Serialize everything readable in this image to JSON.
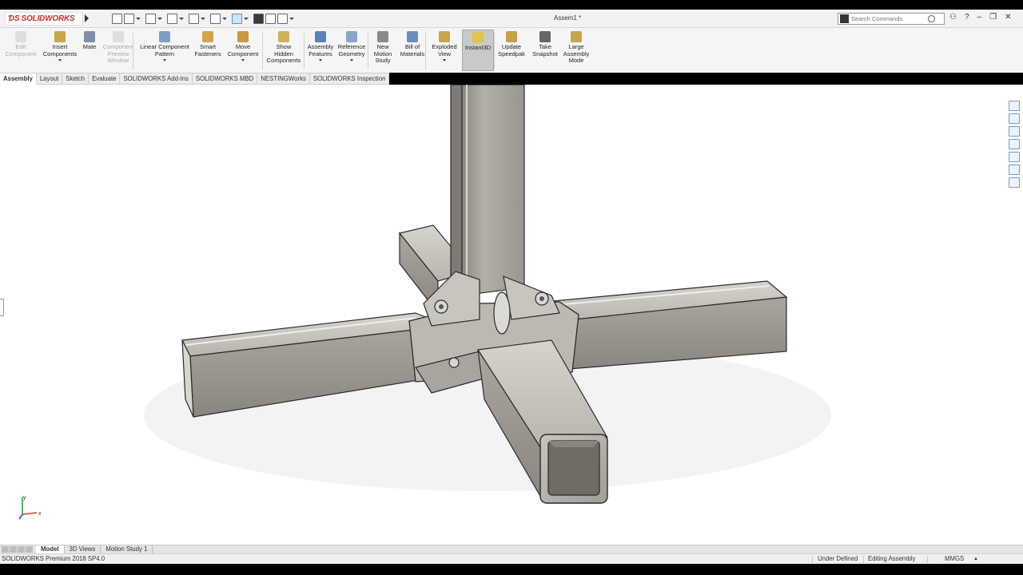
{
  "app": {
    "brand": "SOLIDWORKS",
    "document_title": "Assem1 *"
  },
  "search": {
    "placeholder": "Search Commands"
  },
  "ribbon": {
    "items": [
      {
        "label": "Edit Component",
        "lines": [
          "Edit",
          "Component"
        ],
        "state": "disabled"
      },
      {
        "label": "Insert Components",
        "lines": [
          "Insert",
          "Components"
        ],
        "state": "normal"
      },
      {
        "label": "Mate",
        "lines": [
          "Mate"
        ],
        "state": "normal"
      },
      {
        "label": "Component Preview Window",
        "lines": [
          "Component",
          "Preview",
          "Window"
        ],
        "state": "disabled"
      },
      {
        "label": "Linear Component Pattern",
        "lines": [
          "Linear Component",
          "Pattern"
        ],
        "state": "normal"
      },
      {
        "label": "Smart Fasteners",
        "lines": [
          "Smart",
          "Fasteners"
        ],
        "state": "normal"
      },
      {
        "label": "Move Component",
        "lines": [
          "Move",
          "Component"
        ],
        "state": "normal"
      },
      {
        "label": "Show Hidden Components",
        "lines": [
          "Show",
          "Hidden",
          "Components"
        ],
        "state": "normal"
      },
      {
        "label": "Assembly Features",
        "lines": [
          "Assembly",
          "Features"
        ],
        "state": "normal"
      },
      {
        "label": "Reference Geometry",
        "lines": [
          "Reference",
          "Geometry"
        ],
        "state": "normal"
      },
      {
        "label": "New Motion Study",
        "lines": [
          "New",
          "Motion",
          "Study"
        ],
        "state": "normal"
      },
      {
        "label": "Bill of Materials",
        "lines": [
          "Bill of",
          "Materials"
        ],
        "state": "normal"
      },
      {
        "label": "Exploded View",
        "lines": [
          "Exploded",
          "View"
        ],
        "state": "normal"
      },
      {
        "label": "Instant3D",
        "lines": [
          "Instant3D"
        ],
        "state": "active"
      },
      {
        "label": "Update Speedpak",
        "lines": [
          "Update",
          "Speedpak"
        ],
        "state": "normal"
      },
      {
        "label": "Take Snapshot",
        "lines": [
          "Take",
          "Snapshot"
        ],
        "state": "normal"
      },
      {
        "label": "Large Assembly Mode",
        "lines": [
          "Large",
          "Assembly",
          "Mode"
        ],
        "state": "normal"
      }
    ]
  },
  "tabs": [
    {
      "label": "Assembly",
      "active": true
    },
    {
      "label": "Layout",
      "active": false
    },
    {
      "label": "Sketch",
      "active": false
    },
    {
      "label": "Evaluate",
      "active": false
    },
    {
      "label": "SOLIDWORKS Add-Ins",
      "active": false
    },
    {
      "label": "SOLIDWORKS MBD",
      "active": false
    },
    {
      "label": "NESTINGWorks",
      "active": false
    },
    {
      "label": "SOLIDWORKS Inspection",
      "active": false
    }
  ],
  "bottom_tabs": [
    {
      "label": "Model",
      "active": true
    },
    {
      "label": "3D Views",
      "active": false
    },
    {
      "label": "Motion Study 1",
      "active": false
    }
  ],
  "status": {
    "product": "SOLIDWORKS Premium 2018 SP4.0",
    "definition": "Under Defined",
    "mode": "Editing Assembly",
    "units": "MMGS"
  },
  "triad": {
    "x_label": "x",
    "y_label": "y"
  },
  "colors": {
    "logo_red": "#d52b1e",
    "tube_face_light": "#c9c6c0",
    "tube_face_mid": "#a9a59e",
    "tube_face_dark": "#7e7a73",
    "tube_edge": "#2a2a2a",
    "taskpane_blue": "#7a9cc0"
  }
}
